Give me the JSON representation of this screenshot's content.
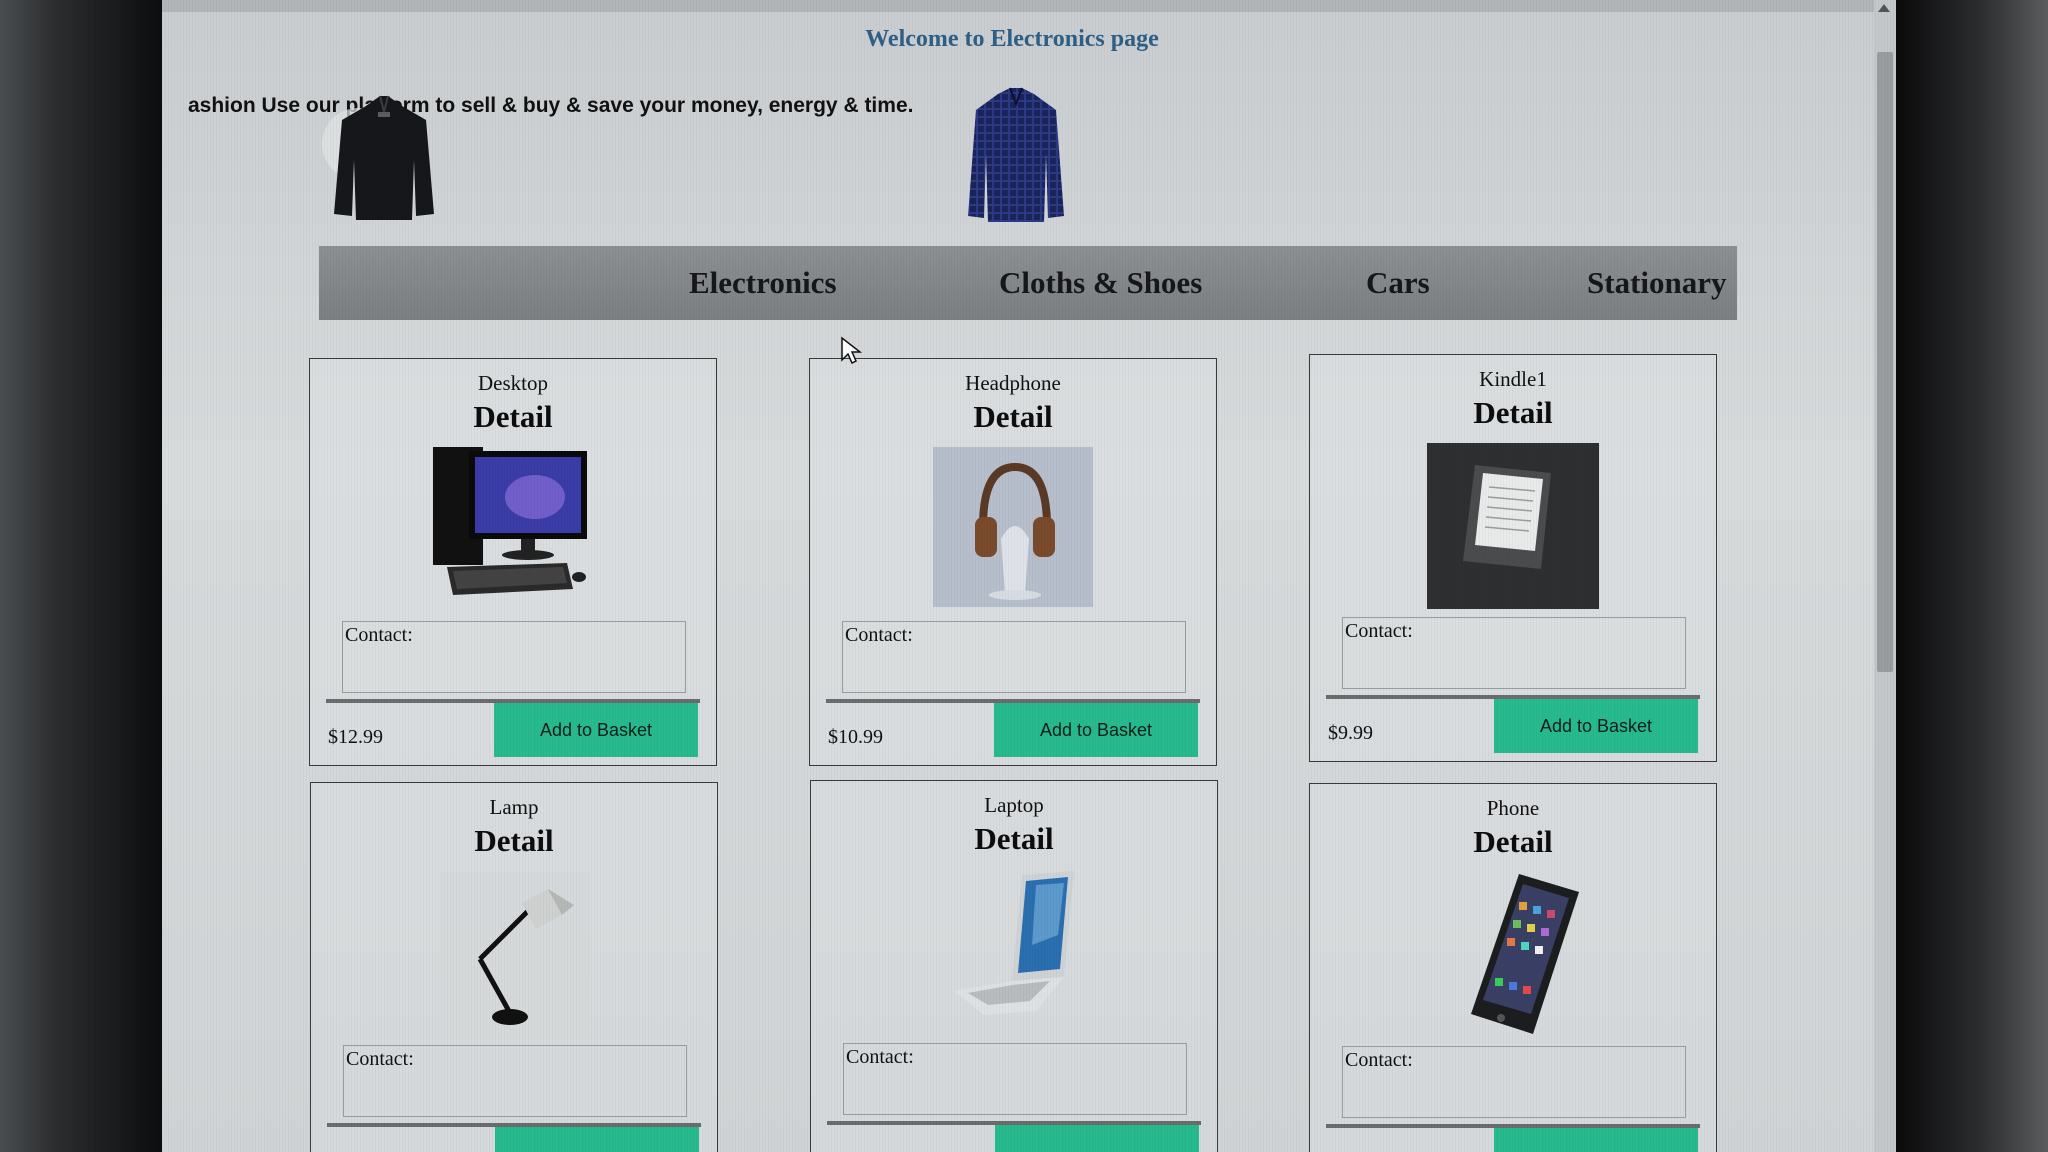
{
  "page": {
    "welcome": "Welcome to Electronics page",
    "marquee": "ashion  Use our platform to sell & buy & save your money, energy & time."
  },
  "nav": {
    "items": [
      {
        "label": "Electronics"
      },
      {
        "label": "Cloths & Shoes"
      },
      {
        "label": "Cars"
      },
      {
        "label": "Stationary"
      }
    ]
  },
  "products": [
    {
      "name": "Desktop",
      "detail": "Detail",
      "contact_label": "Contact:",
      "price": "$12.99",
      "button": "Add to Basket",
      "image": "desktop-computer-image"
    },
    {
      "name": "Headphone",
      "detail": "Detail",
      "contact_label": "Contact:",
      "price": "$10.99",
      "button": "Add to Basket",
      "image": "headphone-image"
    },
    {
      "name": "Kindle1",
      "detail": "Detail",
      "contact_label": "Contact:",
      "price": "$9.99",
      "button": "Add to Basket",
      "image": "kindle-image"
    },
    {
      "name": "Lamp",
      "detail": "Detail",
      "contact_label": "Contact:",
      "price": "",
      "button": "",
      "image": "lamp-image"
    },
    {
      "name": "Laptop",
      "detail": "Detail",
      "contact_label": "Contact:",
      "price": "",
      "button": "",
      "image": "laptop-image"
    },
    {
      "name": "Phone",
      "detail": "Detail",
      "contact_label": "Contact:",
      "price": "",
      "button": "",
      "image": "phone-image"
    }
  ],
  "colors": {
    "button": "#27ba8e",
    "nav_bar": "#85888b",
    "welcome_text": "#2e5f86"
  }
}
